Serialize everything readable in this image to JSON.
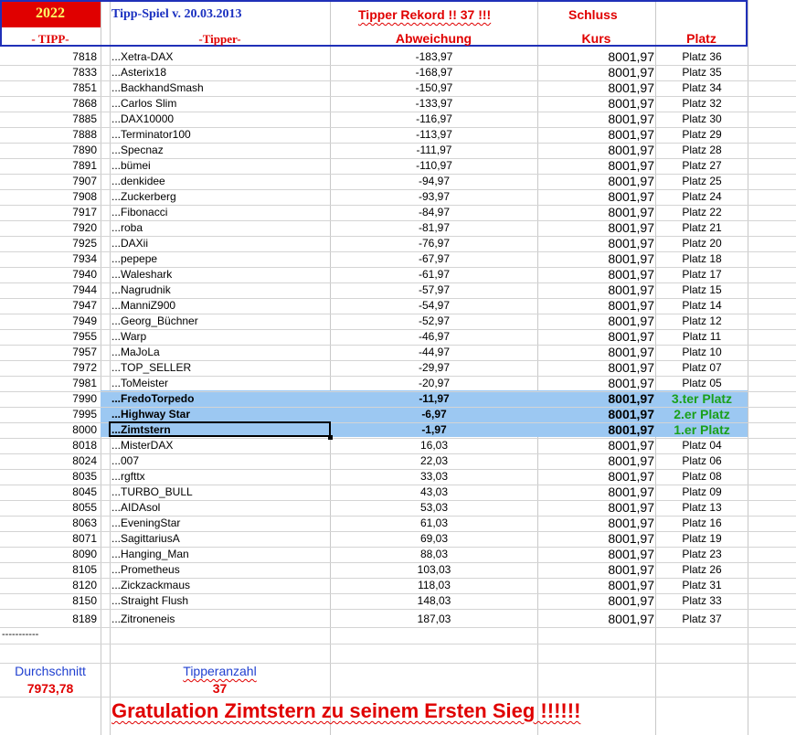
{
  "header": {
    "year": "2022",
    "game_title": "Tipp-Spiel v. 20.03.2013",
    "record_text": "Tipper Rekord !!  37  !!!",
    "schluss": "Schluss",
    "col_tipp": "- TIPP-",
    "col_tipper": "-Tipper-",
    "col_abweichung": "Abweichung",
    "col_kurs": "Kurs",
    "col_platz": "Platz"
  },
  "rows": [
    {
      "tipp": "7818",
      "name": "...Xetra-DAX",
      "dev": "-183,97",
      "kurs": "8001,97",
      "platz": "Platz 36"
    },
    {
      "tipp": "7833",
      "name": "...Asterix18",
      "dev": "-168,97",
      "kurs": "8001,97",
      "platz": "Platz 35"
    },
    {
      "tipp": "7851",
      "name": "...BackhandSmash",
      "dev": "-150,97",
      "kurs": "8001,97",
      "platz": "Platz 34"
    },
    {
      "tipp": "7868",
      "name": "...Carlos Slim",
      "dev": "-133,97",
      "kurs": "8001,97",
      "platz": "Platz 32"
    },
    {
      "tipp": "7885",
      "name": "...DAX10000",
      "dev": "-116,97",
      "kurs": "8001,97",
      "platz": "Platz 30"
    },
    {
      "tipp": "7888",
      "name": "...Terminator100",
      "dev": "-113,97",
      "kurs": "8001,97",
      "platz": "Platz 29"
    },
    {
      "tipp": "7890",
      "name": "...Specnaz",
      "dev": "-111,97",
      "kurs": "8001,97",
      "platz": "Platz 28"
    },
    {
      "tipp": "7891",
      "name": "...bümei",
      "dev": "-110,97",
      "kurs": "8001,97",
      "platz": "Platz 27"
    },
    {
      "tipp": "7907",
      "name": "...denkidee",
      "dev": "-94,97",
      "kurs": "8001,97",
      "platz": "Platz 25"
    },
    {
      "tipp": "7908",
      "name": "...Zuckerberg",
      "dev": "-93,97",
      "kurs": "8001,97",
      "platz": "Platz 24"
    },
    {
      "tipp": "7917",
      "name": "...Fibonacci",
      "dev": "-84,97",
      "kurs": "8001,97",
      "platz": "Platz 22"
    },
    {
      "tipp": "7920",
      "name": "...roba",
      "dev": "-81,97",
      "kurs": "8001,97",
      "platz": "Platz 21"
    },
    {
      "tipp": "7925",
      "name": "...DAXii",
      "dev": "-76,97",
      "kurs": "8001,97",
      "platz": "Platz 20"
    },
    {
      "tipp": "7934",
      "name": "...pepepe",
      "dev": "-67,97",
      "kurs": "8001,97",
      "platz": "Platz 18"
    },
    {
      "tipp": "7940",
      "name": "...Waleshark",
      "dev": "-61,97",
      "kurs": "8001,97",
      "platz": "Platz 17"
    },
    {
      "tipp": "7944",
      "name": "...Nagrudnik",
      "dev": "-57,97",
      "kurs": "8001,97",
      "platz": "Platz 15"
    },
    {
      "tipp": "7947",
      "name": "...ManniZ900",
      "dev": "-54,97",
      "kurs": "8001,97",
      "platz": "Platz 14"
    },
    {
      "tipp": "7949",
      "name": "...Georg_Büchner",
      "dev": "-52,97",
      "kurs": "8001,97",
      "platz": "Platz 12"
    },
    {
      "tipp": "7955",
      "name": "...Warp",
      "dev": "-46,97",
      "kurs": "8001,97",
      "platz": "Platz 11"
    },
    {
      "tipp": "7957",
      "name": "...MaJoLa",
      "dev": "-44,97",
      "kurs": "8001,97",
      "platz": "Platz 10"
    },
    {
      "tipp": "7972",
      "name": "...TOP_SELLER",
      "dev": "-29,97",
      "kurs": "8001,97",
      "platz": "Platz 07"
    },
    {
      "tipp": "7981",
      "name": "...ToMeister",
      "dev": "-20,97",
      "kurs": "8001,97",
      "platz": "Platz 05"
    },
    {
      "tipp": "7990",
      "name": "...FredoTorpedo",
      "dev": "-11,97",
      "kurs": "8001,97",
      "platz": "3.ter Platz",
      "highlight": true
    },
    {
      "tipp": "7995",
      "name": "...Highway Star",
      "dev": "-6,97",
      "kurs": "8001,97",
      "platz": "2.er Platz",
      "highlight": true
    },
    {
      "tipp": "8000",
      "name": "...Zimtstern",
      "dev": "-1,97",
      "kurs": "8001,97",
      "platz": "1.er Platz",
      "highlight": true
    },
    {
      "tipp": "8018",
      "name": "...MisterDAX",
      "dev": "16,03",
      "kurs": "8001,97",
      "platz": "Platz 04"
    },
    {
      "tipp": "8024",
      "name": "...007",
      "dev": "22,03",
      "kurs": "8001,97",
      "platz": "Platz 06"
    },
    {
      "tipp": "8035",
      "name": "...rgfttx",
      "dev": "33,03",
      "kurs": "8001,97",
      "platz": "Platz 08"
    },
    {
      "tipp": "8045",
      "name": "...TURBO_BULL",
      "dev": "43,03",
      "kurs": "8001,97",
      "platz": "Platz 09"
    },
    {
      "tipp": "8055",
      "name": "...AIDAsol",
      "dev": "53,03",
      "kurs": "8001,97",
      "platz": "Platz 13"
    },
    {
      "tipp": "8063",
      "name": "...EveningStar",
      "dev": "61,03",
      "kurs": "8001,97",
      "platz": "Platz 16"
    },
    {
      "tipp": "8071",
      "name": "...SagittariusA",
      "dev": "69,03",
      "kurs": "8001,97",
      "platz": "Platz 19"
    },
    {
      "tipp": "8090",
      "name": "...Hanging_Man",
      "dev": "88,03",
      "kurs": "8001,97",
      "platz": "Platz 23"
    },
    {
      "tipp": "8105",
      "name": "...Prometheus",
      "dev": "103,03",
      "kurs": "8001,97",
      "platz": "Platz 26"
    },
    {
      "tipp": "8120",
      "name": "...Zickzackmaus",
      "dev": "118,03",
      "kurs": "8001,97",
      "platz": "Platz 31"
    },
    {
      "tipp": "8150",
      "name": "...Straight Flush",
      "dev": "148,03",
      "kurs": "8001,97",
      "platz": "Platz 33"
    },
    {
      "tipp": "8189",
      "name": "...Zitroneneis",
      "dev": "187,03",
      "kurs": "8001,97",
      "platz": "Platz 37"
    }
  ],
  "footer": {
    "separator": "-----------",
    "avg_label": "Durchschnitt",
    "avg_value": "7973,78",
    "count_label": "Tipperanzahl",
    "count_value": "37",
    "congrats": "Gratulation Zimtstern  zu seinem Ersten Sieg !!!!!!"
  },
  "colors": {
    "header_red": "#e00000",
    "header_blue": "#1a30c0",
    "year_text": "#ffff66",
    "highlight": "#9cc8f2",
    "top3_green": "#1aa01a"
  }
}
